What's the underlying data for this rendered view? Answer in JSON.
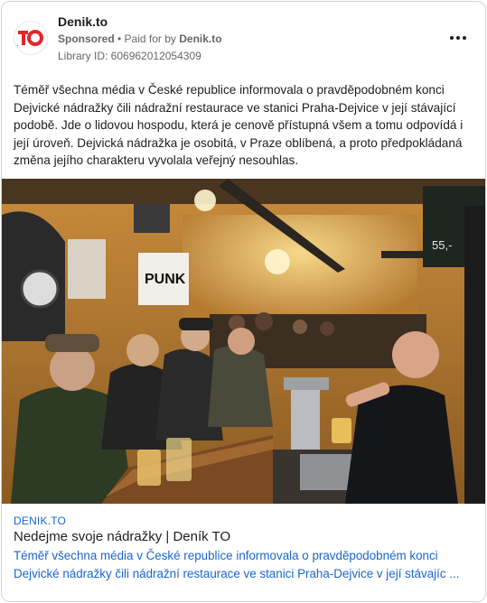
{
  "advertiser": {
    "name": "Denik.to",
    "logo_text": "TO",
    "sponsored_label": "Sponsored",
    "separator": " • ",
    "paid_for_prefix": "Paid for by ",
    "paid_for_name": "Denik.to",
    "library_id": "Library ID: 606962012054309"
  },
  "menu": {
    "icon": "more-horizontal-icon"
  },
  "body": {
    "text": "Téměř všechna média v České republice informovala o pravděpodobném konci Dejvické nádražky čili nádražní restaurace ve stanici Praha-Dejvice v její stávající podobě. Jde o lidovou hospodu, která je cenově přístupná všem a tomu odpovídá i její úroveň. Dejvická nádražka je osobitá, v Praze oblíbená, a proto předpokládaná změna jejího charakteru vyvolala veřejný nesouhlas."
  },
  "photo": {
    "wall_sign": "PUNK",
    "chalkboard_price": "55,-"
  },
  "link": {
    "domain": "DENIK.TO",
    "title": "Nedejme svoje nádražky | Deník TO",
    "description": "Téměř všechna média v České republice informovala o pravděpodobném konci Dejvické nádražky čili nádražní restaurace ve stanici Praha-Dejvice v její stávajíc ..."
  },
  "colors": {
    "brand_red": "#e3262b",
    "link_blue": "#1a66c8",
    "muted": "#65676b"
  }
}
